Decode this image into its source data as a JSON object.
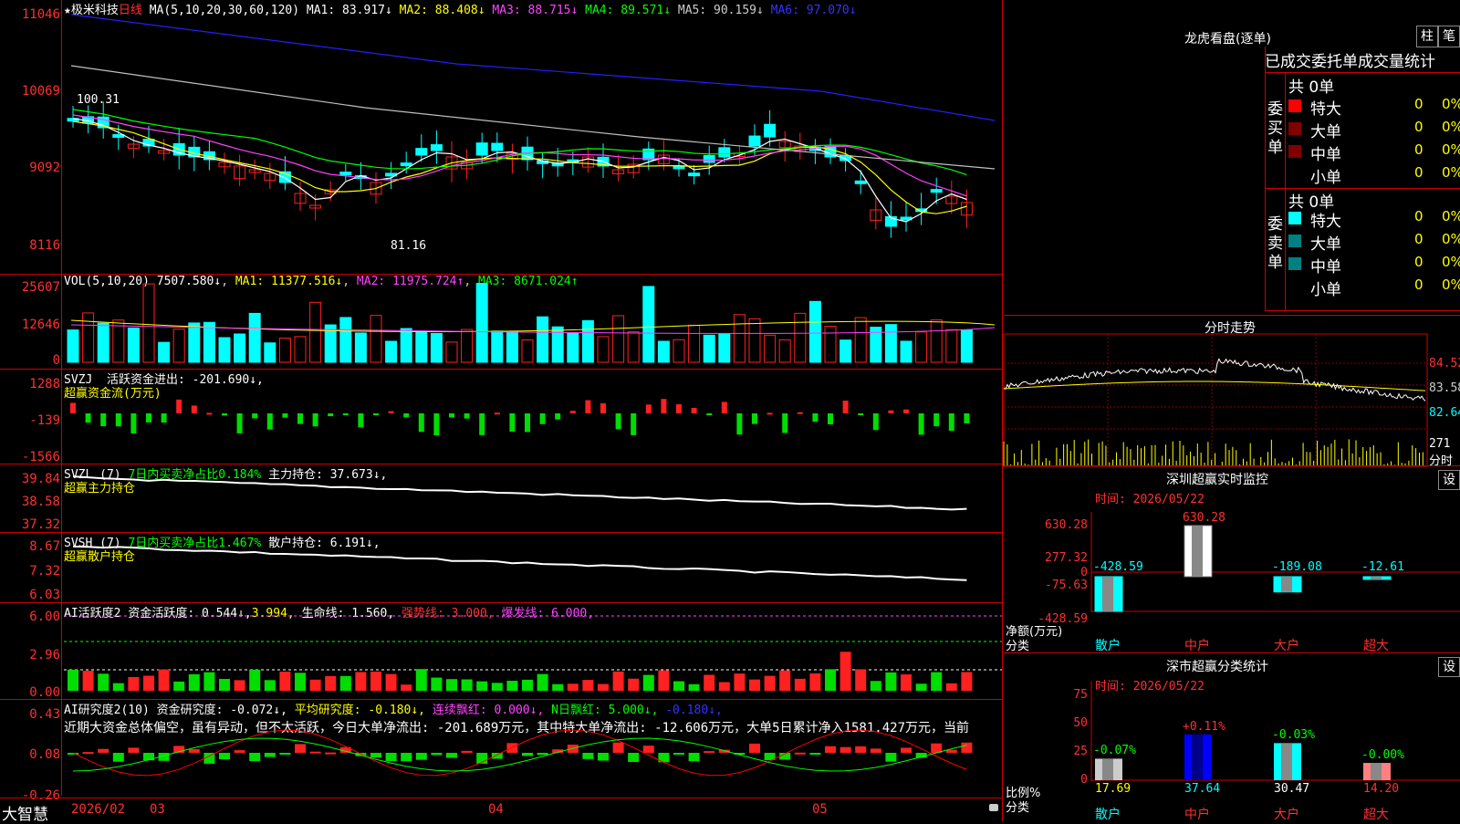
{
  "colors": {
    "up": "#ff2020",
    "down": "#00ffff",
    "grid": "#c00000",
    "ma1": "#ffffff",
    "ma2": "#ffff00",
    "ma3": "#ff40ff",
    "ma4": "#00ff00",
    "ma5": "#c0c0c0",
    "ma6": "#2020ff"
  },
  "kline": {
    "star": "★",
    "name": "极米科技",
    "period": "日线",
    "ma_label": "MA(5,10,20,30,60,120)",
    "ma1": "MA1: 83.917↓",
    "ma2": "MA2: 88.408↓",
    "ma3": "MA3: 88.715↓",
    "ma4": "MA4: 89.571↓",
    "ma5": "MA5: 90.159↓",
    "ma6": "MA6: 97.070↓",
    "axis": [
      "11046",
      "10069",
      "9092",
      "8116"
    ],
    "high_label": "100.31",
    "low_label": "81.16"
  },
  "vol": {
    "label": "VOL(5,10,20)",
    "value": "7507.580↓",
    "ma1": "MA1: 11377.516↓",
    "ma2": "MA2: 11975.724↑",
    "ma3": "MA3: 8671.024↑",
    "axis": [
      "25607",
      "12646",
      "0"
    ]
  },
  "svzj": {
    "label": "SVZJ",
    "title": "活跃资金进出: -201.690↓,",
    "sub": "超赢资金流(万元)",
    "axis": [
      "1288",
      "-139",
      "-1566"
    ]
  },
  "svzl": {
    "label": "SVZL (7)",
    "pct": "7日内买卖净占比0.184%",
    "pos": "主力持仓: 37.673↓,",
    "sub": "超赢主力持仓",
    "axis": [
      "39.84",
      "38.58",
      "37.32"
    ]
  },
  "svsh": {
    "label": "SVSH (7)",
    "pct": "7日内买卖净占比1.467%",
    "pos": "散户持仓: 6.191↓,",
    "sub": "超赢散户持仓",
    "axis": [
      "8.67",
      "7.32",
      "6.03"
    ]
  },
  "ai1": {
    "label": "AI活跃度2",
    "active": "资金活跃度: 0.544↓,",
    "v2": "3.994,",
    "life": "生命线: 1.560,",
    "strong": "强势线: 3.000,",
    "burst": "爆发线: 6.000,",
    "axis": [
      "6.00",
      "2.96",
      "0.00"
    ]
  },
  "ai2": {
    "label": "AI研究度2(10)",
    "research": "资金研究度: -0.072↓,",
    "avg": "平均研究度: -0.180↓,",
    "red": "连续飘红: 0.000↓,",
    "nred": "N日飘红: 5.000↓,",
    "v5": "-0.180↓,",
    "comment": "近期大资金总体偏空，虽有异动，但不太活跃，今日大单净流出: -201.689万元，其中特大单净流出: -12.606万元，大单5日累计净入1581.427万元，当前",
    "axis": [
      "0.43",
      "0.08",
      "-0.26"
    ]
  },
  "bottom": {
    "brand": "大智慧",
    "dates": [
      "2026/02",
      "03",
      "04",
      "05"
    ]
  },
  "dragon": {
    "title": "龙虎看盘(逐单)",
    "btn1": "柱",
    "btn2": "笔",
    "header": "已成交委托单成交量统计",
    "buy_label": "委买单",
    "sell_label": "委卖单",
    "buy_total": "共 0单",
    "sell_total": "共 0单",
    "rows": [
      "特大",
      "大单",
      "中单",
      "小单"
    ],
    "zero": "0",
    "pct": "0%",
    "buy_colors": [
      "#ff0000",
      "#800000",
      "#800000",
      "#000000"
    ],
    "sell_colors": [
      "#00ffff",
      "#008080",
      "#008080",
      "#000000"
    ]
  },
  "intraday": {
    "title": "分时走势",
    "axis": [
      "84.52",
      "83.58",
      "82.64"
    ],
    "vol_axis": [
      "271",
      "分时"
    ]
  },
  "monitor": {
    "title": "深圳超赢实时监控",
    "btn": "设",
    "time": "时间: 2026/05/22",
    "axis": [
      "630.28",
      "277.32",
      "0",
      "-75.63",
      "-428.59"
    ],
    "ylabel": "净额(万元)",
    "xlabel": "分类",
    "cats": [
      "散户",
      "中户",
      "大户",
      "超大"
    ],
    "values": [
      "-428.59",
      "630.28",
      "-189.08",
      "-12.61"
    ]
  },
  "stats": {
    "title": "深市超赢分类统计",
    "btn": "设",
    "time": "时间: 2026/05/22",
    "axis": [
      "75",
      "50",
      "25",
      "0"
    ],
    "ylabel": "比例%",
    "xlabel": "分类",
    "cats": [
      "散户",
      "中户",
      "大户",
      "超大"
    ],
    "ratios": [
      "17.69",
      "37.64",
      "30.47",
      "14.20"
    ],
    "changes": [
      "-0.07%",
      "+0.11%",
      "-0.03%",
      "-0.00%"
    ]
  }
}
